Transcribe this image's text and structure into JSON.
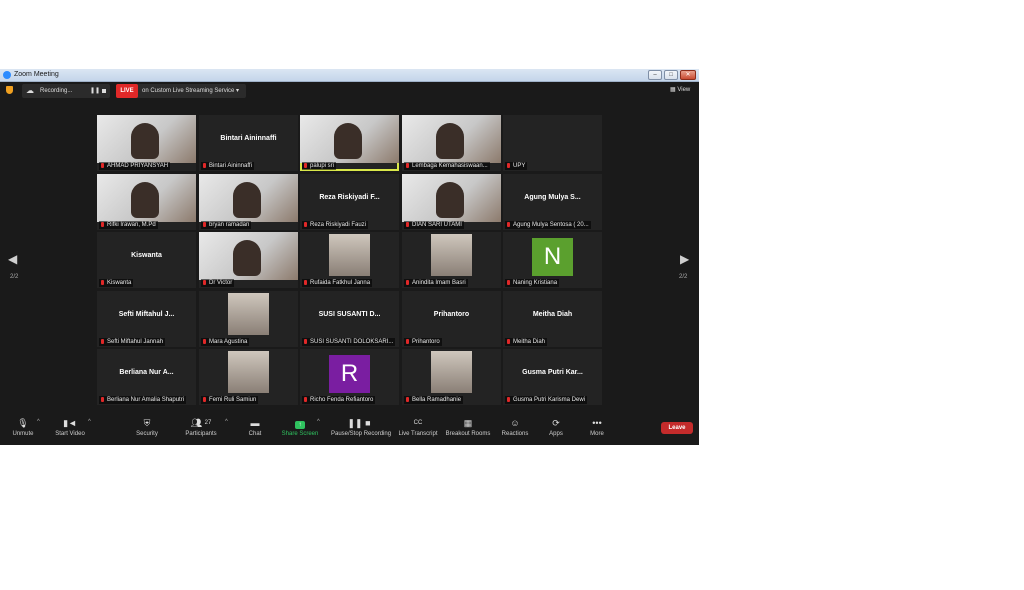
{
  "window": {
    "title": "Zoom Meeting",
    "minimize": "–",
    "maximize": "□",
    "close": "✕"
  },
  "topbar": {
    "recording_label": "Recording...",
    "live_badge": "LIVE",
    "live_label": "on Custom Live Streaming Service",
    "view_label": "View"
  },
  "page_indicator": {
    "left": "2/2",
    "right": "2/2"
  },
  "participants": [
    {
      "label": "AHMAD PRIYANSYAH",
      "name_display": "",
      "kind": "video"
    },
    {
      "label": "Bintari Aininnaffi",
      "name_display": "Bintari Aininnaffi",
      "kind": "name"
    },
    {
      "label": "palupi sri",
      "name_display": "",
      "kind": "video",
      "active": true
    },
    {
      "label": "Lembaga Kemahasiswaan...",
      "name_display": "",
      "kind": "video"
    },
    {
      "label": "UPY",
      "name_display": "",
      "kind": "blank"
    },
    {
      "label": "Rifki Irawan, M.Pd",
      "name_display": "",
      "kind": "video"
    },
    {
      "label": "bryan ramadan",
      "name_display": "",
      "kind": "video"
    },
    {
      "label": "Reza Riskiyadi Fauzi",
      "name_display": "Reza Riskiyadi F...",
      "kind": "name"
    },
    {
      "label": "DIAN SARI UTAMI",
      "name_display": "",
      "kind": "video"
    },
    {
      "label": "Agung Mulya Sentosa ( 20...",
      "name_display": "Agung Mulya S...",
      "kind": "name"
    },
    {
      "label": "Kiswanta",
      "name_display": "Kiswanta",
      "kind": "name"
    },
    {
      "label": "Dr Victor",
      "name_display": "",
      "kind": "video"
    },
    {
      "label": "Rufaida Fatkhul Janna",
      "name_display": "",
      "kind": "photo"
    },
    {
      "label": "Anindita Imam Basri",
      "name_display": "",
      "kind": "photo"
    },
    {
      "label": "Naning Kristiana",
      "name_display": "",
      "kind": "avatar",
      "initial": "N",
      "color": "#5ba02e"
    },
    {
      "label": "Sefti Miftahul Jannah",
      "name_display": "Sefti Miftahul J...",
      "kind": "name"
    },
    {
      "label": "Mara Agustina",
      "name_display": "",
      "kind": "photo"
    },
    {
      "label": "SUSI SUSANTI DOLOKSARI...",
      "name_display": "SUSI SUSANTI D...",
      "kind": "name"
    },
    {
      "label": "Prihantoro",
      "name_display": "Prihantoro",
      "kind": "name"
    },
    {
      "label": "Meitha Diah",
      "name_display": "Meitha Diah",
      "kind": "name"
    },
    {
      "label": "Berliana Nur Amalia Shaputri",
      "name_display": "Berliana Nur A...",
      "kind": "name"
    },
    {
      "label": "Femi Ruli Samiun",
      "name_display": "",
      "kind": "photo"
    },
    {
      "label": "Richo Fenda Refiantoro",
      "name_display": "",
      "kind": "avatar",
      "initial": "R",
      "color": "#7a1ea1"
    },
    {
      "label": "Bella Ramadhanie",
      "name_display": "",
      "kind": "photo"
    },
    {
      "label": "Gusma Putri Karisma Dewi",
      "name_display": "Gusma Putri Kar...",
      "kind": "name"
    }
  ],
  "toolbar": {
    "unmute": "Unmute",
    "start_video": "Start Video",
    "security": "Security",
    "participants": "Participants",
    "participants_count": "27",
    "chat": "Chat",
    "share_screen": "Share Screen",
    "pause_stop": "Pause/Stop Recording",
    "live_transcript": "Live Transcript",
    "breakout_rooms": "Breakout Rooms",
    "reactions": "Reactions",
    "apps": "Apps",
    "more": "More",
    "leave": "Leave"
  },
  "colors": {
    "leave": "#c42b2b",
    "live": "#e02828",
    "share": "#2fc25f",
    "active_speaker": "#d9e84a"
  }
}
